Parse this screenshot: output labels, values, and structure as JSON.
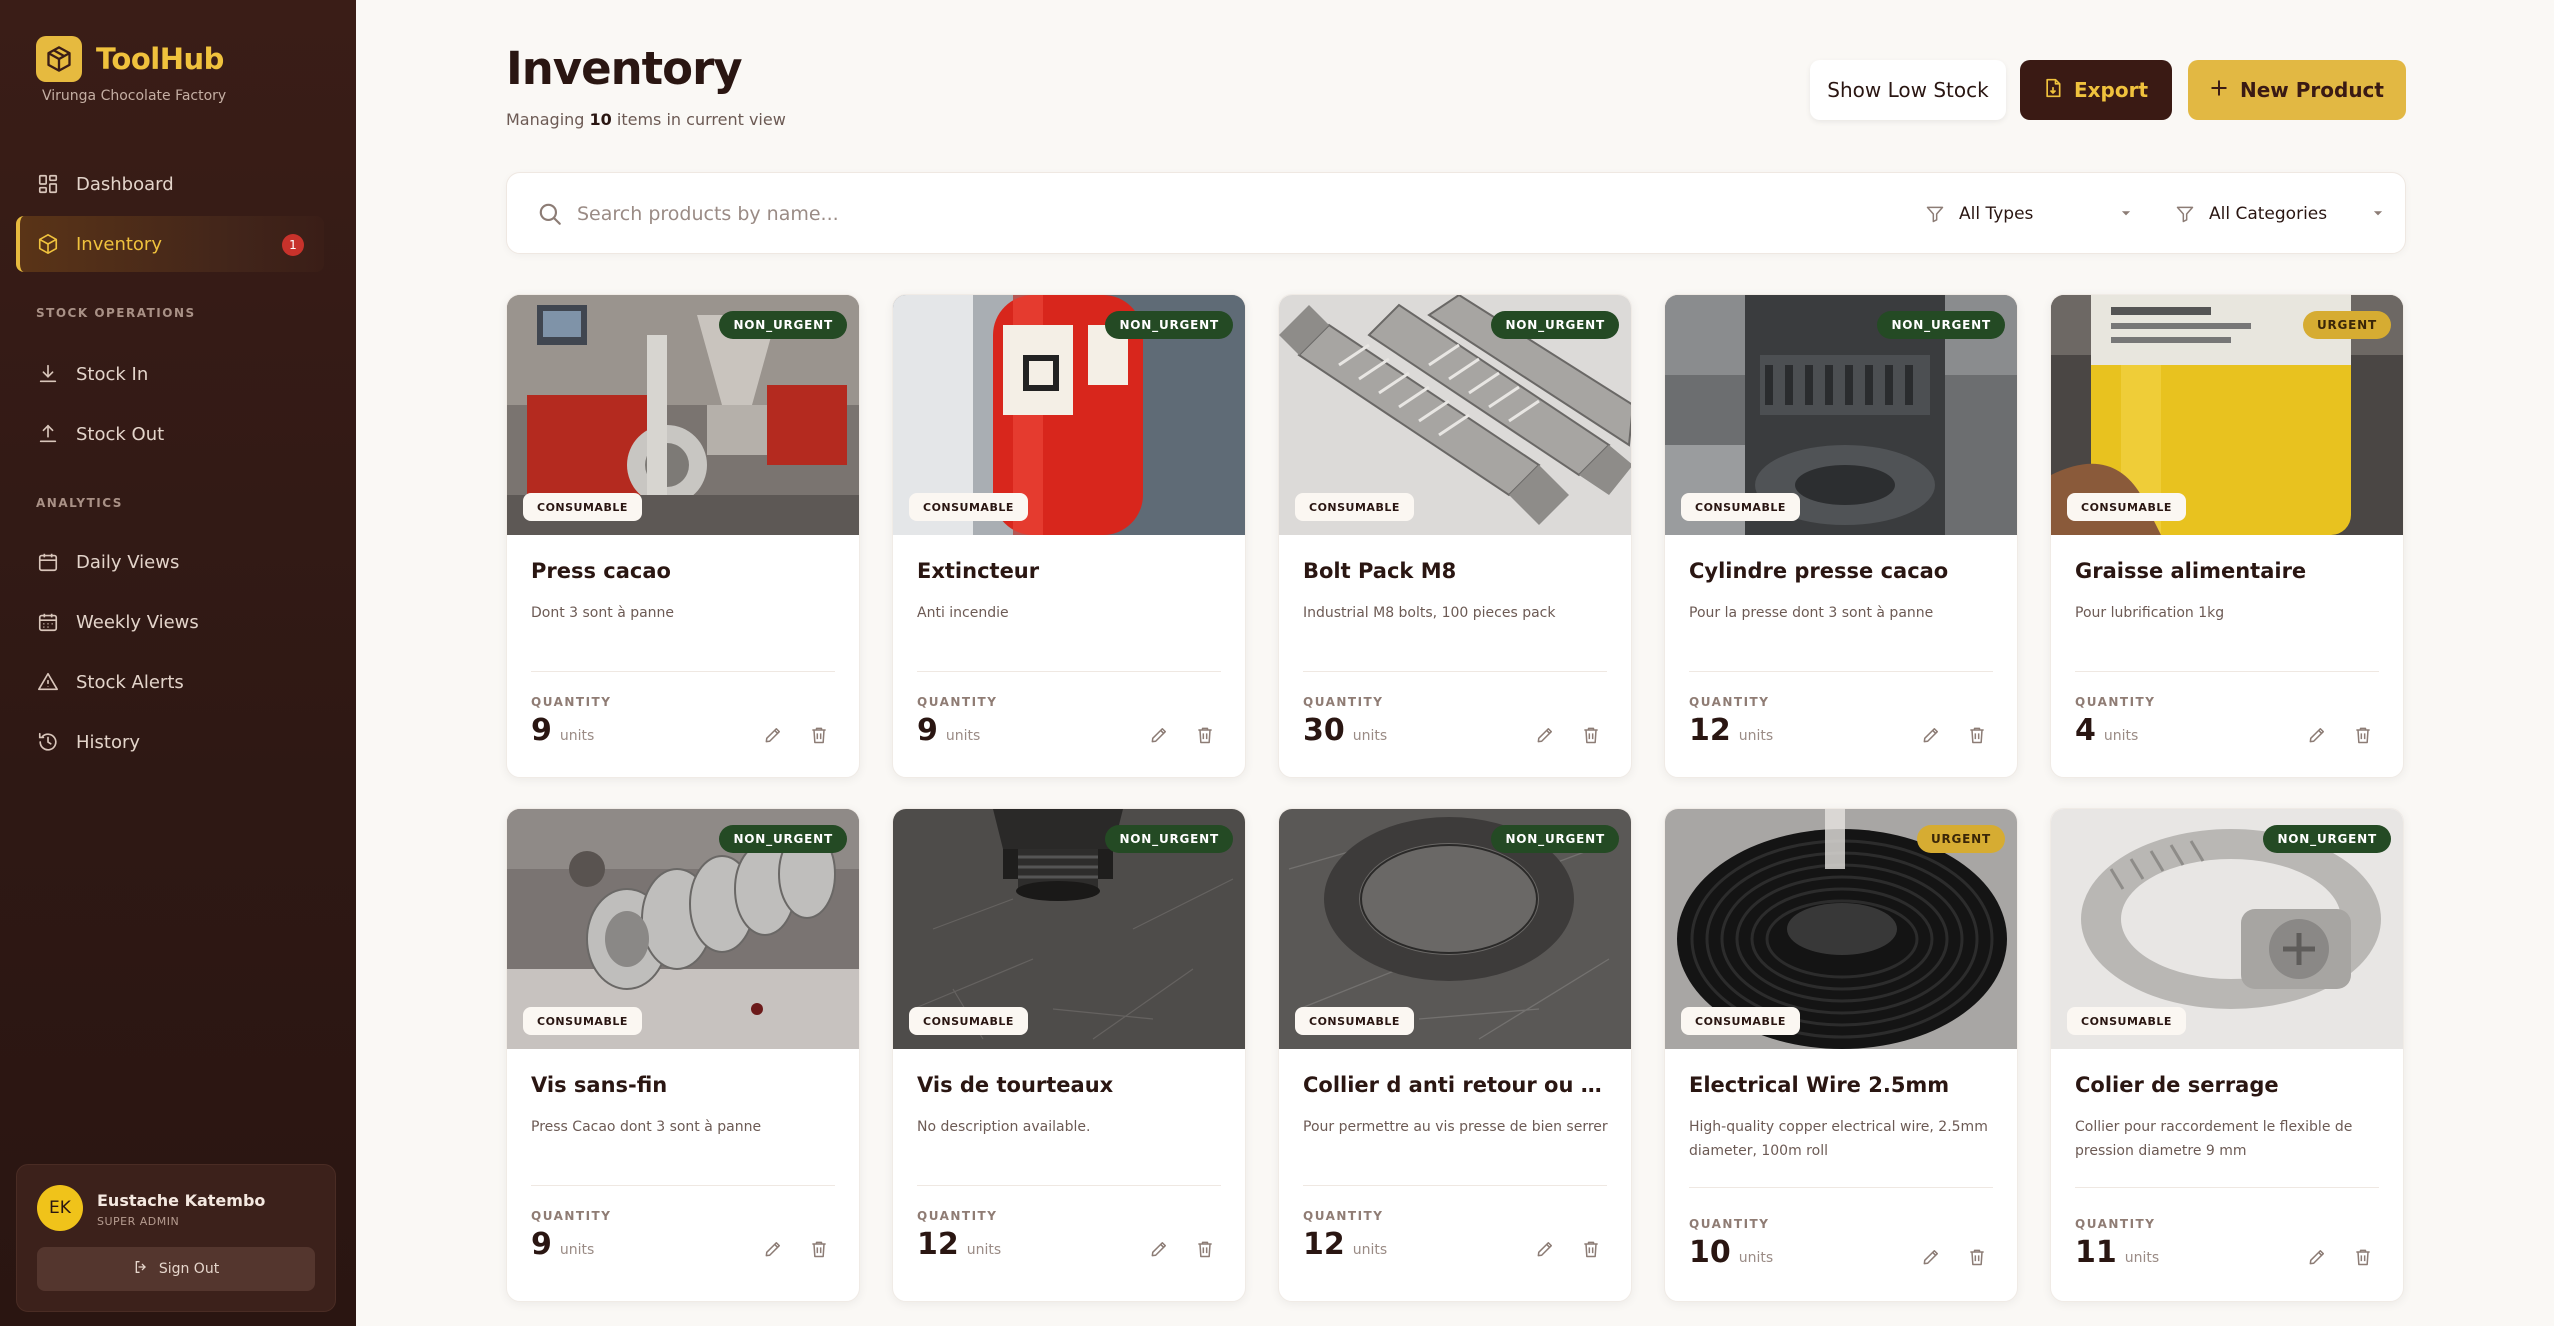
{
  "brand": {
    "name": "ToolHub",
    "subtitle": "Virunga Chocolate Factory"
  },
  "nav": {
    "main": [
      {
        "label": "Dashboard",
        "icon": "dashboard-icon"
      },
      {
        "label": "Inventory",
        "icon": "cube-icon",
        "active": true,
        "badge": "1"
      }
    ],
    "stock_section": "STOCK OPERATIONS",
    "stock": [
      {
        "label": "Stock In",
        "icon": "download-icon"
      },
      {
        "label": "Stock Out",
        "icon": "upload-icon"
      }
    ],
    "analytics_section": "ANALYTICS",
    "analytics": [
      {
        "label": "Daily Views",
        "icon": "calendar-icon"
      },
      {
        "label": "Weekly Views",
        "icon": "calendar-grid-icon"
      },
      {
        "label": "Stock Alerts",
        "icon": "alert-triangle-icon"
      },
      {
        "label": "History",
        "icon": "history-icon"
      }
    ]
  },
  "user": {
    "initials": "EK",
    "name": "Eustache Katembo",
    "role": "SUPER ADMIN",
    "signout": "Sign Out"
  },
  "header": {
    "title": "Inventory",
    "sub_prefix": "Managing ",
    "sub_count": "10",
    "sub_suffix": " items in current view",
    "show_low_stock": "Show Low Stock",
    "export": "Export",
    "new_product": "New Product"
  },
  "filters": {
    "search_placeholder": "Search products by name...",
    "type_value": "All Types",
    "category_value": "All Categories"
  },
  "labels": {
    "quantity": "QUANTITY",
    "units": "units"
  },
  "colors": {
    "sidebar_bg": "#3a1d17",
    "accent_gold": "#e6ba3f",
    "badge_non_urgent": "#244a24",
    "badge_urgent": "#d6ac32",
    "alert_red": "#c7322b"
  },
  "products": [
    {
      "name": "Press cacao",
      "desc": "Dont 3 sont à panne",
      "urgency": "NON_URGENT",
      "type": "CONSUMABLE",
      "qty": "9"
    },
    {
      "name": "Extincteur",
      "desc": "Anti incendie",
      "urgency": "NON_URGENT",
      "type": "CONSUMABLE",
      "qty": "9"
    },
    {
      "name": "Bolt Pack M8",
      "desc": "Industrial M8 bolts, 100 pieces pack",
      "urgency": "NON_URGENT",
      "type": "CONSUMABLE",
      "qty": "30"
    },
    {
      "name": "Cylindre presse cacao",
      "desc": "Pour la presse dont 3 sont à panne",
      "urgency": "NON_URGENT",
      "type": "CONSUMABLE",
      "qty": "12"
    },
    {
      "name": "Graisse alimentaire",
      "desc": "Pour lubrification 1kg",
      "urgency": "URGENT",
      "type": "CONSUMABLE",
      "qty": "4"
    },
    {
      "name": "Vis sans-fin",
      "desc": "Press Cacao dont 3 sont à panne",
      "urgency": "NON_URGENT",
      "type": "CONSUMABLE",
      "qty": "9"
    },
    {
      "name": "Vis de tourteaux",
      "desc": "No description available.",
      "urgency": "NON_URGENT",
      "type": "CONSUMABLE",
      "qty": "12"
    },
    {
      "name": "Collier d anti retour ou de...",
      "desc": "Pour permettre au vis presse de bien serrer",
      "urgency": "NON_URGENT",
      "type": "CONSUMABLE",
      "qty": "12"
    },
    {
      "name": "Electrical Wire 2.5mm",
      "desc": "High-quality copper electrical wire, 2.5mm diameter, 100m roll",
      "urgency": "URGENT",
      "type": "CONSUMABLE",
      "qty": "10"
    },
    {
      "name": "Colier de serrage",
      "desc": "Collier pour raccordement le flexible de pression diametre 9 mm",
      "urgency": "NON_URGENT",
      "type": "CONSUMABLE",
      "qty": "11"
    }
  ]
}
